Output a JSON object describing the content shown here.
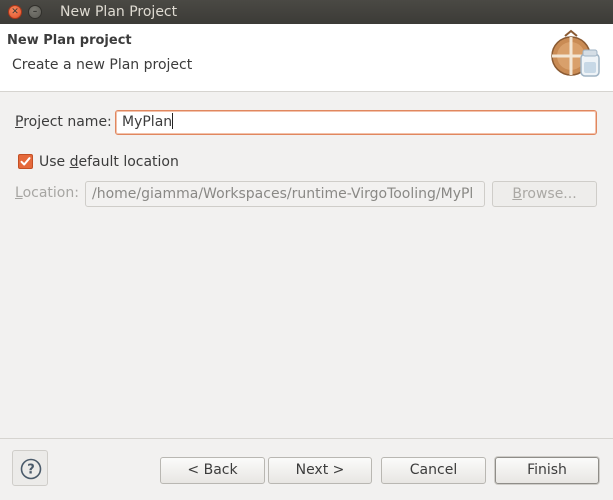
{
  "window": {
    "title": "New Plan Project"
  },
  "banner": {
    "title": "New Plan project",
    "description": "Create a new Plan project",
    "icon": "plan-project-wizard-icon"
  },
  "form": {
    "project_name": {
      "label_prefix": "",
      "label_mnemonic": "P",
      "label_rest": "roject name:",
      "value": "MyPlan"
    },
    "use_default_location": {
      "checked": true,
      "label_prefix": "Use ",
      "label_mnemonic": "d",
      "label_rest": "efault location"
    },
    "location": {
      "label_prefix": "",
      "label_mnemonic": "L",
      "label_rest": "ocation:",
      "value": "/home/giamma/Workspaces/runtime-VirgoTooling/MyPl",
      "enabled": false
    },
    "browse_button": {
      "label_prefix": "",
      "label_mnemonic": "B",
      "label_rest": "rowse...",
      "enabled": false
    }
  },
  "buttons": {
    "back": "< Back",
    "next": "Next >",
    "cancel": "Cancel",
    "finish": "Finish"
  },
  "colors": {
    "accent": "#e5693b",
    "titlebar": "#3c3b37",
    "dialog_bg": "#f2f1f0"
  }
}
